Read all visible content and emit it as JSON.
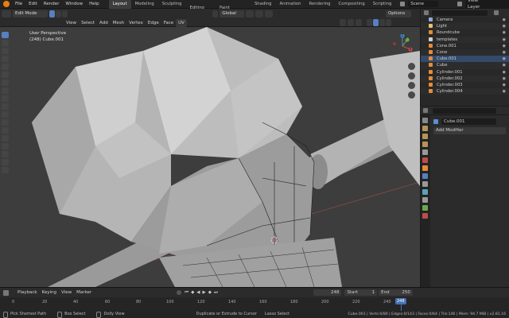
{
  "topbar": {
    "menus": [
      "File",
      "Edit",
      "Render",
      "Window",
      "Help"
    ],
    "workspaces": [
      "Layout",
      "Modeling",
      "Sculpting",
      "UV Editing",
      "Texture Paint",
      "Shading",
      "Animation",
      "Rendering",
      "Compositing",
      "Scripting"
    ],
    "active_workspace": "Layout",
    "scene": "Scene",
    "view_layer": "View Layer"
  },
  "header": {
    "mode": "Edit Mode",
    "transform_orientation": "Global",
    "options": "Options",
    "menus": [
      "View",
      "Select",
      "Add",
      "Mesh",
      "Vertex",
      "Edge",
      "Face",
      "UV"
    ]
  },
  "viewport": {
    "overlay_title": "User Perspective",
    "overlay_object": "(248) Cube.001",
    "gizmo_labels": [
      "Y",
      "Z",
      "X"
    ]
  },
  "outliner": {
    "items": [
      {
        "label": "Camera",
        "color": "#9aa7d6"
      },
      {
        "label": "Light",
        "color": "#e3c66a"
      },
      {
        "label": "Roundcube",
        "color": "#e38b3a"
      },
      {
        "label": "templates",
        "color": "#cfcfcf"
      },
      {
        "label": "Cone.001",
        "color": "#e38b3a"
      },
      {
        "label": "Cone",
        "color": "#e38b3a"
      },
      {
        "label": "Cube.001",
        "color": "#e38b3a"
      },
      {
        "label": "Cube",
        "color": "#e38b3a"
      },
      {
        "label": "Cylinder.001",
        "color": "#e38b3a"
      },
      {
        "label": "Cylinder.002",
        "color": "#e38b3a"
      },
      {
        "label": "Cylinder.003",
        "color": "#e38b3a"
      },
      {
        "label": "Cylinder.004",
        "color": "#e38b3a"
      }
    ]
  },
  "properties": {
    "object_name": "Cube.001",
    "add_modifier": "Add Modifier"
  },
  "timeline": {
    "menus": [
      "Playback",
      "Keying",
      "View",
      "Marker"
    ],
    "current_frame": "248",
    "start_label": "Start",
    "start": "1",
    "end_label": "End",
    "end": "250",
    "ticks": [
      "0",
      "20",
      "40",
      "60",
      "80",
      "100",
      "120",
      "140",
      "160",
      "180",
      "200",
      "220",
      "240"
    ],
    "playhead": "248"
  },
  "statusbar": {
    "left": [
      "Pick Shortest Path",
      "Box Select",
      "Dolly View"
    ],
    "middle": [
      "Duplicate or Extrude to Cursor",
      "Lasso Select"
    ],
    "stats": "Cube.001 | Verts:0/80 | Edges:0/143 | Faces:0/64 | Tris:146 | Mem: 94.7 MiB | v2.81.16"
  },
  "colors": {
    "accent": "#5680c2",
    "viewport_bg": "#3d3d3d",
    "mesh": "#a9a9a9",
    "active_frame": "#4772b3"
  }
}
